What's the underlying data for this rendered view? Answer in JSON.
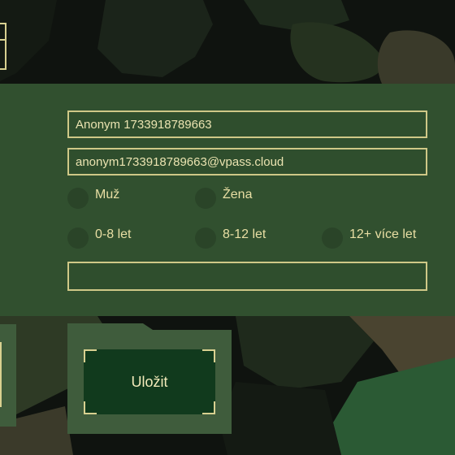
{
  "form": {
    "name_value": "Anonym 1733918789663",
    "email_value": "anonym1733918789663@vpass.cloud",
    "extra_value": "",
    "gender": {
      "options": [
        "Muž",
        "Žena"
      ]
    },
    "age": {
      "options": [
        "0-8 let",
        "8-12 let",
        "12+ více let"
      ]
    }
  },
  "actions": {
    "save_label": "Uložit"
  },
  "colors": {
    "panel": "#31502f",
    "border": "#cfc887",
    "text": "#e9dfa4",
    "button": "#113a1d"
  }
}
